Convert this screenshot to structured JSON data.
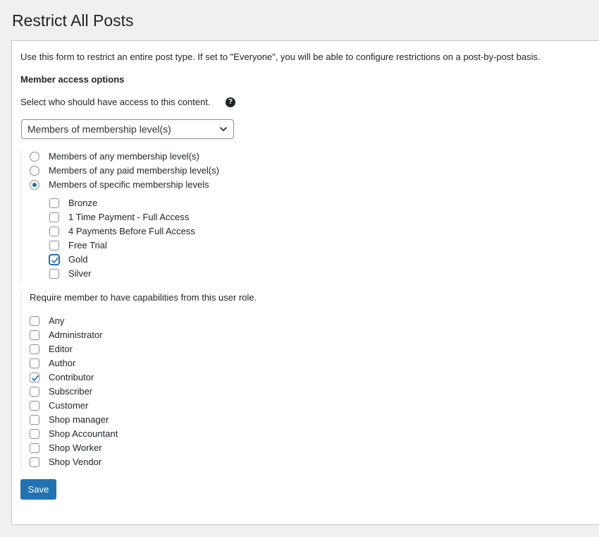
{
  "page_title": "Restrict All Posts",
  "intro": "Use this form to restrict an entire post type. If set to \"Everyone\", you will be able to configure restrictions on a post-by-post basis.",
  "member_access": {
    "heading": "Member access options",
    "select_prompt": "Select who should have access to this content.",
    "help_icon": "question-mark-icon",
    "select_value": "Members of membership level(s)",
    "radio_options": [
      {
        "label": "Members of any membership level(s)",
        "checked": false
      },
      {
        "label": "Members of any paid membership level(s)",
        "checked": false
      },
      {
        "label": "Members of specific membership levels",
        "checked": true
      }
    ],
    "levels": [
      {
        "label": "Bronze",
        "checked": false
      },
      {
        "label": "1 Time Payment - Full Access",
        "checked": false
      },
      {
        "label": "4 Payments Before Full Access",
        "checked": false
      },
      {
        "label": "Free Trial",
        "checked": false
      },
      {
        "label": "Gold",
        "checked": true
      },
      {
        "label": "Silver",
        "checked": false
      }
    ]
  },
  "roles": {
    "prompt": "Require member to have capabilities from this user role.",
    "items": [
      {
        "label": "Any",
        "checked": false
      },
      {
        "label": "Administrator",
        "checked": false
      },
      {
        "label": "Editor",
        "checked": false
      },
      {
        "label": "Author",
        "checked": false
      },
      {
        "label": "Contributor",
        "checked": true
      },
      {
        "label": "Subscriber",
        "checked": false
      },
      {
        "label": "Customer",
        "checked": false
      },
      {
        "label": "Shop manager",
        "checked": false
      },
      {
        "label": "Shop Accountant",
        "checked": false
      },
      {
        "label": "Shop Worker",
        "checked": false
      },
      {
        "label": "Shop Vendor",
        "checked": false
      }
    ]
  },
  "save_label": "Save",
  "colors": {
    "accent": "#2271b1",
    "text": "#1d2327",
    "background": "#f0f0f1",
    "border": "#8c8f94"
  }
}
